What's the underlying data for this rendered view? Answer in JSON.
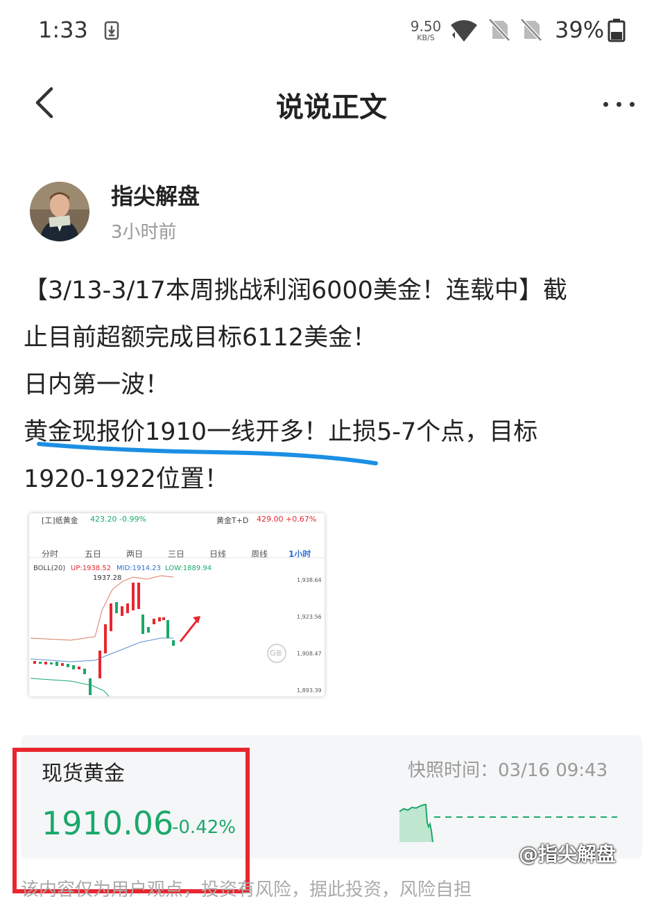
{
  "status_bar": {
    "time": "1:33",
    "net_speed_value": "9.50",
    "net_speed_unit": "KB/S",
    "battery_pct": "39%"
  },
  "header": {
    "title": "说说正文"
  },
  "post": {
    "author": "指尖解盘",
    "time_ago": "3小时前",
    "lines": [
      "【3/13-3/17本周挑战利润6000美金！连载中】截",
      "止目前超额完成目标6112美金！",
      " 日内第一波！",
      " 黄金现报价1910一线开多！止损5-7个点，目标",
      "1920-1922位置！"
    ]
  },
  "chart_image": {
    "left_label": "[工]纸黄金",
    "left_value": "423.20 -0.99%",
    "right_label": "黄金T+D",
    "right_value": "429.00 +0.67%",
    "tabs": [
      "分时",
      "五日",
      "两日",
      "三日",
      "日线",
      "周线",
      "1小时"
    ],
    "active_tab": "1小时",
    "boll_label": "BOLL(20)",
    "boll_up": "UP:1938.52",
    "boll_mid": "MID:1914.23",
    "boll_low": "LOW:1889.94",
    "peak_label": "1937.28",
    "y_ticks": [
      "1,938.64",
      "1,923.56",
      "1,908.47",
      "1,893.39"
    ],
    "logo": "G≣"
  },
  "quote": {
    "name": "现货黄金",
    "price": "1910.06",
    "change": "-0.42%",
    "snapshot": "快照时间：03/16 09:43"
  },
  "watermark": "@指尖解盘",
  "disclaimer": "该内容仅为用户观点，投资有风险，据此投资，风险自担",
  "colors": {
    "up_red": "#e8262f",
    "down_green": "#1aa86a",
    "underline_blue": "#1b8fe3"
  }
}
